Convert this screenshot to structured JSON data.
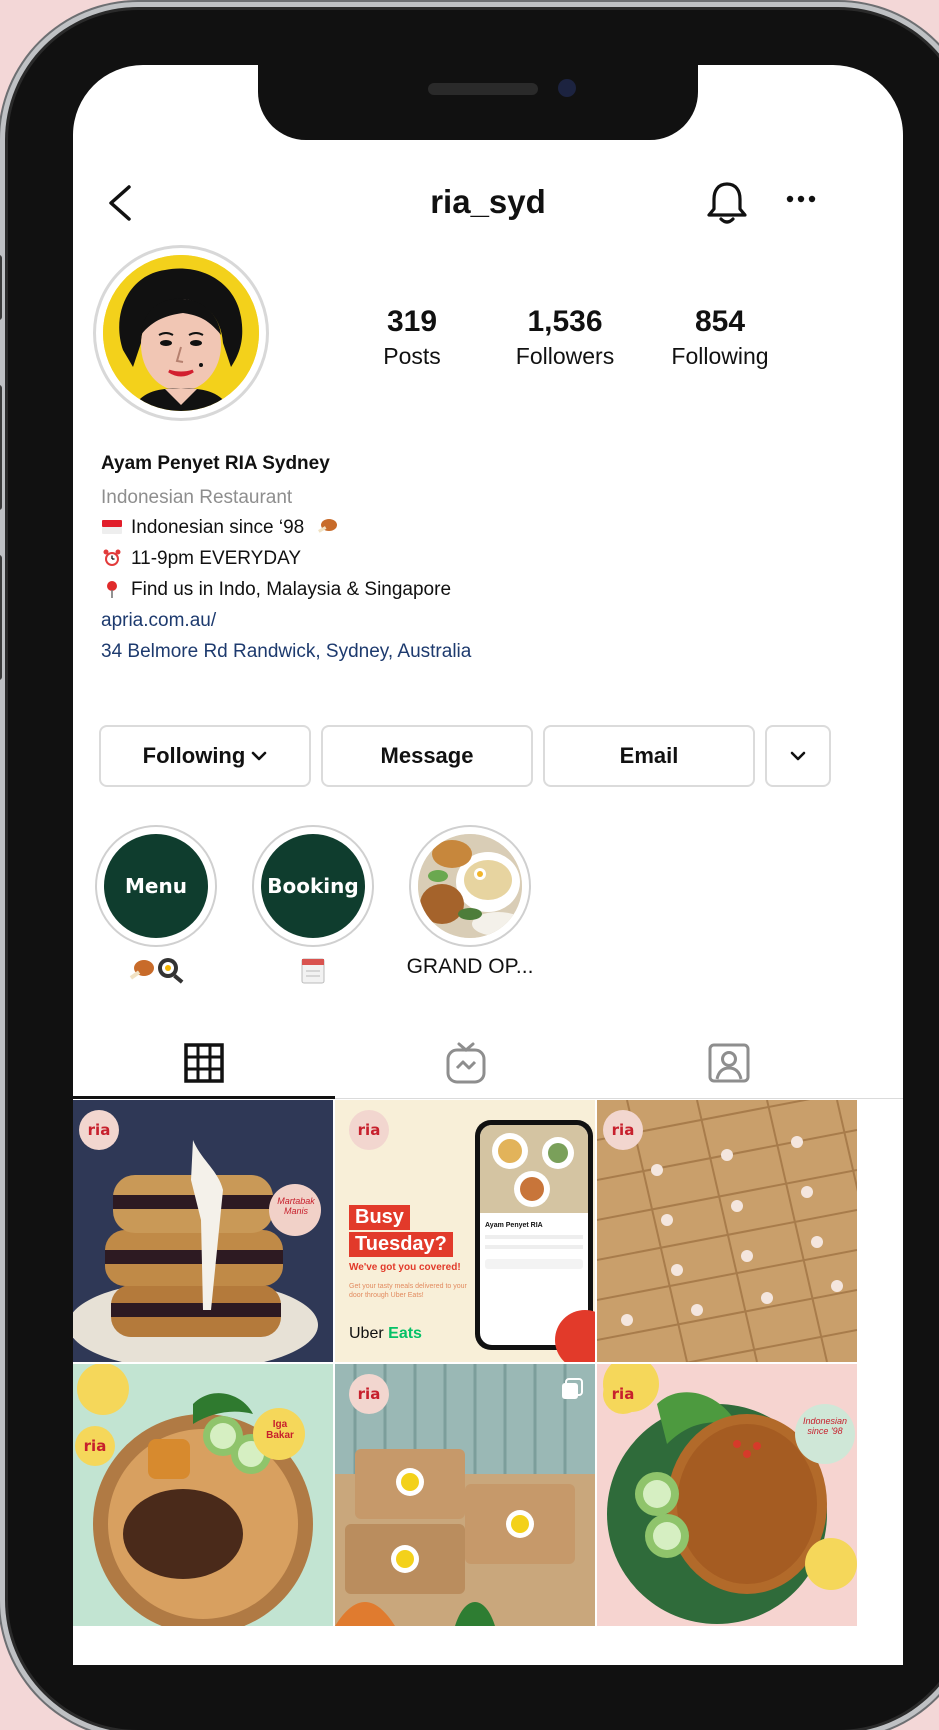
{
  "profile": {
    "username": "ria_syd",
    "stats": [
      {
        "value": "319",
        "label": "Posts"
      },
      {
        "value": "1,536",
        "label": "Followers"
      },
      {
        "value": "854",
        "label": "Following"
      }
    ],
    "name": "Ayam Penyet RIA Sydney",
    "category": "Indonesian Restaurant",
    "bio_lines": [
      "Indonesian since ‘98",
      "11-9pm EVERYDAY",
      "Find us in Indo, Malaysia & Singapore"
    ],
    "link": "apria.com.au/",
    "address": "34 Belmore Rd Randwick, Sydney, Australia"
  },
  "actions": {
    "following": "Following",
    "message": "Message",
    "email": "Email"
  },
  "highlights": [
    {
      "title": "Menu",
      "label": ""
    },
    {
      "title": "Booking",
      "label": ""
    },
    {
      "title": "",
      "label": "GRAND OP..."
    }
  ],
  "posts": {
    "busy_title_1": "Busy",
    "busy_title_2": "Tuesday?",
    "busy_sub": "We've got you covered!",
    "busy_small": "Get your tasty meals delivered to your door through Uber Eats!",
    "uber_brand_1": "Uber",
    "uber_brand_2": "Eats",
    "phone_title": "Ayam Penyet RIA",
    "badge_text": "ria",
    "martabak": "Martabak Manis",
    "iga": "Iga Bakar",
    "indonesian_since": "Indonesian since '98"
  },
  "colors": {
    "link": "#1d3a6e",
    "highlight_green": "#0f3d2e",
    "brand_red": "#c7202d"
  }
}
